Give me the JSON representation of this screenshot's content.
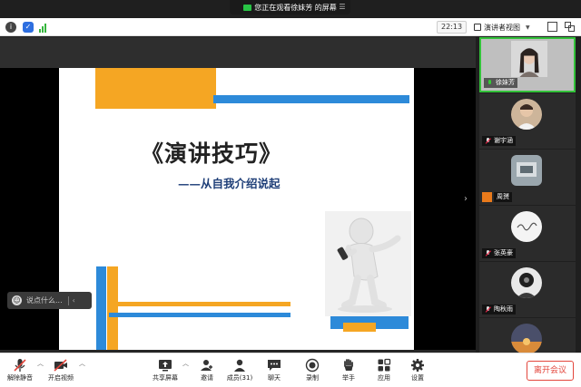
{
  "share_banner": {
    "text": "您正在观看徐妹芳 的屏幕",
    "menu_icon": "menu-icon"
  },
  "topbar": {
    "timer": "22:13",
    "view_label": "演讲者视图",
    "icons": [
      "info-icon",
      "shield-icon",
      "signal-icon",
      "fullscreen-icon",
      "window-icon"
    ]
  },
  "slide": {
    "title": "《演讲技巧》",
    "subtitle": "——从自我介绍说起",
    "colors": {
      "orange": "#f5a623",
      "blue": "#2d8ad9"
    }
  },
  "chat": {
    "placeholder": "说点什么..."
  },
  "participants": [
    {
      "name": "徐妹芳",
      "mic": "on",
      "active": true
    },
    {
      "name": "谢宇涵",
      "mic": "off"
    },
    {
      "name": "周赟",
      "mic": "off",
      "camera_badge": true
    },
    {
      "name": "张英豪",
      "mic": "off"
    },
    {
      "name": "陶秋雨",
      "mic": "off"
    }
  ],
  "toolbar": {
    "mute": "解除静音",
    "video": "开启视频",
    "share": "共享屏幕",
    "invite": "邀请",
    "members": "成员(31)",
    "chat": "聊天",
    "record": "录制",
    "raise_hand": "举手",
    "apps": "应用",
    "settings": "设置",
    "leave": "离开会议"
  }
}
